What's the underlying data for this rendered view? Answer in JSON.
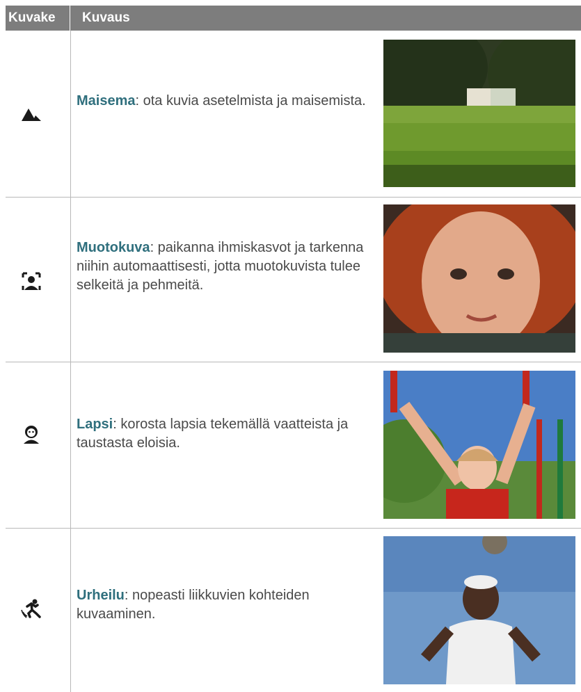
{
  "table": {
    "header": {
      "icon_col": "Kuvake",
      "desc_col": "Kuvaus"
    },
    "rows": [
      {
        "icon": "landscape-icon",
        "title": "Maisema",
        "text": ": ota kuvia asetelmista ja maisemista.",
        "photo": "landscape-photo"
      },
      {
        "icon": "portrait-face-icon",
        "title": "Muotokuva",
        "text": ": paikanna ihmiskasvot ja tarkenna niihin automaattisesti, jotta muotokuvista tulee selkeitä ja pehmeitä.",
        "photo": "portrait-photo"
      },
      {
        "icon": "child-icon",
        "title": "Lapsi",
        "text": ": korosta lapsia tekemällä vaatteista ja taustasta eloisia.",
        "photo": "child-photo"
      },
      {
        "icon": "sports-runner-icon",
        "title": "Urheilu",
        "text": ": nopeasti liikkuvien kohteiden kuvaaminen.",
        "photo": "sports-photo"
      }
    ]
  }
}
